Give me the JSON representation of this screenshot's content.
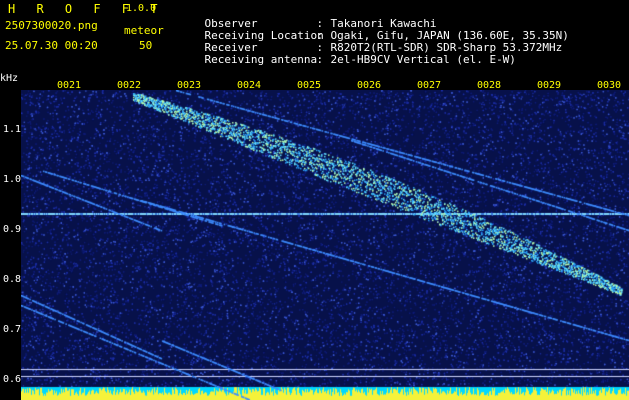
{
  "app": {
    "title": "H R O F F T",
    "version": "1.0.0"
  },
  "capture": {
    "filename": "2507300020.png",
    "kind": "meteor",
    "timestamp": "25.07.30 00:20",
    "count": "50"
  },
  "info": [
    {
      "label": "Observer",
      "value": "Takanori Kawachi"
    },
    {
      "label": "Receiving Location",
      "value": "Ogaki, Gifu, JAPAN (136.60E, 35.35N)"
    },
    {
      "label": "Receiver",
      "value": "R820T2(RTL-SDR) SDR-Sharp 53.372MHz"
    },
    {
      "label": "Receiving antenna",
      "value": "2el-HB9CV Vertical (el. E-W)"
    }
  ],
  "axis": {
    "unit": "kHz",
    "y_ticks": [
      "1.1",
      "1.0",
      "0.9",
      "0.8",
      "0.7",
      "0.6"
    ],
    "x_ticks": [
      "0021",
      "0022",
      "0023",
      "0024",
      "0025",
      "0026",
      "0027",
      "0028",
      "0029",
      "0030"
    ]
  },
  "colors": {
    "header_text": "#ffff00",
    "noise": "#1a2c9e",
    "signal": "#79e3ff",
    "grid": "#ffffff"
  },
  "spectrogram": {
    "beacon_khz": 0.935,
    "meteor_trail_start_khz": 1.17,
    "meteor_trail_end_khz": 0.78
  }
}
